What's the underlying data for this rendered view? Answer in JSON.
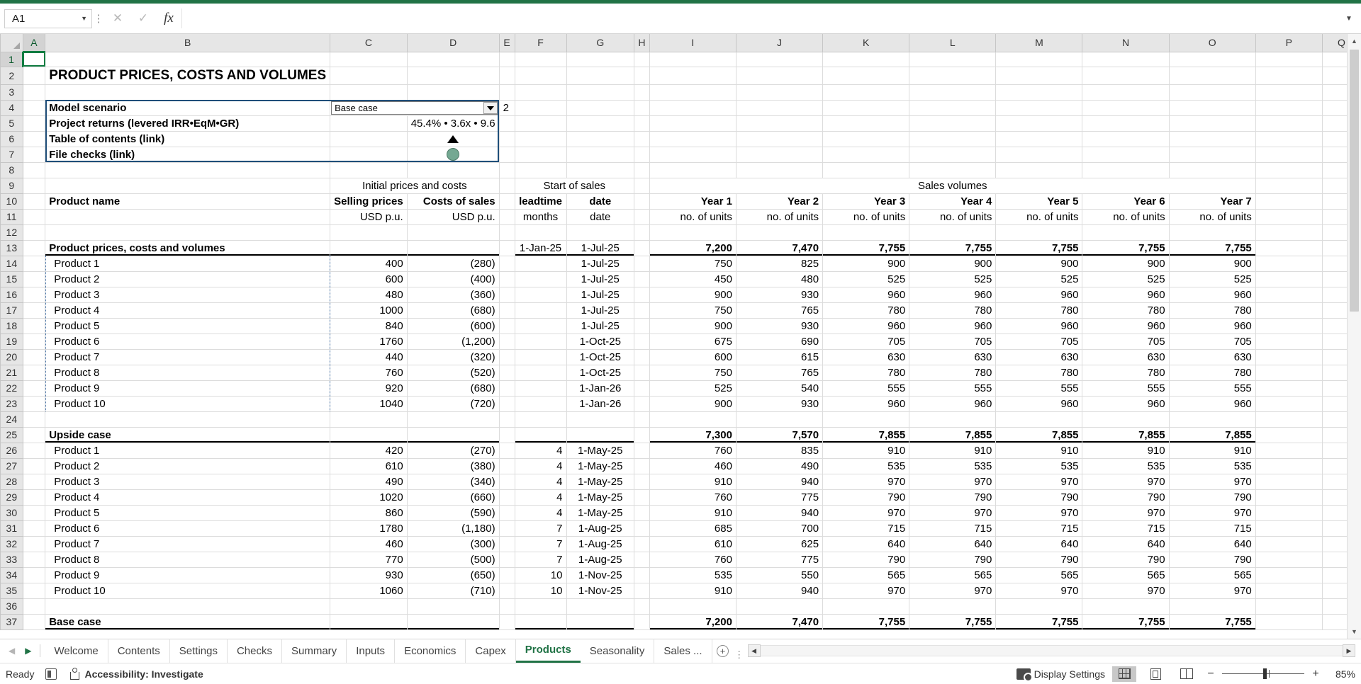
{
  "namebox": {
    "value": "A1"
  },
  "formula_bar": {
    "value": "",
    "cancel_icon": "cancel-icon",
    "confirm_icon": "confirm-icon",
    "fx_icon": "function-icon"
  },
  "columns": [
    "A",
    "B",
    "C",
    "D",
    "E",
    "F",
    "G",
    "H",
    "I",
    "J",
    "K",
    "L",
    "M",
    "N",
    "O",
    "P",
    "Q"
  ],
  "rows": [
    1,
    2,
    3,
    4,
    5,
    6,
    7,
    8,
    9,
    10,
    11,
    12,
    13,
    14,
    15,
    16,
    17,
    18,
    19,
    20,
    21,
    22,
    23,
    24,
    25,
    26,
    27,
    28,
    29,
    30,
    31,
    32,
    33,
    34,
    35,
    36,
    37
  ],
  "sheet": {
    "title": "PRODUCT PRICES, COSTS AND VOLUMES",
    "control_panel": {
      "labels": [
        "Model scenario",
        "Project returns (levered IRR•EqM•GR)",
        "Table of contents (link)",
        "File checks (link)"
      ],
      "scenario_value": "Base case",
      "scenario_index": "2",
      "returns_value": "45.4% • 3.6x • 9.6",
      "toc_icon": "triangle-up-icon",
      "checks_icon": "green-status-dot-icon"
    },
    "group_headers": {
      "initial": "Initial prices and costs",
      "start": "Start of sales",
      "volumes": "Sales volumes"
    },
    "col_headers": {
      "product_name": "Product name",
      "selling_prices": "Selling prices",
      "costs_of_sales": "Costs of sales",
      "leadtime": "leadtime",
      "date": "date",
      "years": [
        "Year 1",
        "Year 2",
        "Year 3",
        "Year 4",
        "Year 5",
        "Year 6",
        "Year 7"
      ]
    },
    "units": {
      "selling_prices": "USD p.u.",
      "costs_of_sales": "USD p.u.",
      "leadtime": "months",
      "date": "date",
      "years": [
        "no. of units",
        "no. of units",
        "no. of units",
        "no. of units",
        "no. of units",
        "no. of units",
        "no. of units"
      ]
    },
    "sections": [
      {
        "name": "Product prices, costs and volumes",
        "row": 13,
        "leadtime_total": "1-Jan-25",
        "date_total": "1-Jul-25",
        "totals": [
          "7,200",
          "7,470",
          "7,755",
          "7,755",
          "7,755",
          "7,755",
          "7,755"
        ],
        "rows": [
          {
            "row": 14,
            "name": "Product 1",
            "price": "400",
            "cost": "(280)",
            "leadtime": "",
            "date": "1-Jul-25",
            "volumes": [
              "750",
              "825",
              "900",
              "900",
              "900",
              "900",
              "900"
            ]
          },
          {
            "row": 15,
            "name": "Product 2",
            "price": "600",
            "cost": "(400)",
            "leadtime": "",
            "date": "1-Jul-25",
            "volumes": [
              "450",
              "480",
              "525",
              "525",
              "525",
              "525",
              "525"
            ]
          },
          {
            "row": 16,
            "name": "Product 3",
            "price": "480",
            "cost": "(360)",
            "leadtime": "",
            "date": "1-Jul-25",
            "volumes": [
              "900",
              "930",
              "960",
              "960",
              "960",
              "960",
              "960"
            ]
          },
          {
            "row": 17,
            "name": "Product 4",
            "price": "1000",
            "cost": "(680)",
            "leadtime": "",
            "date": "1-Jul-25",
            "volumes": [
              "750",
              "765",
              "780",
              "780",
              "780",
              "780",
              "780"
            ]
          },
          {
            "row": 18,
            "name": "Product 5",
            "price": "840",
            "cost": "(600)",
            "leadtime": "",
            "date": "1-Jul-25",
            "volumes": [
              "900",
              "930",
              "960",
              "960",
              "960",
              "960",
              "960"
            ]
          },
          {
            "row": 19,
            "name": "Product 6",
            "price": "1760",
            "cost": "(1,200)",
            "leadtime": "",
            "date": "1-Oct-25",
            "volumes": [
              "675",
              "690",
              "705",
              "705",
              "705",
              "705",
              "705"
            ]
          },
          {
            "row": 20,
            "name": "Product 7",
            "price": "440",
            "cost": "(320)",
            "leadtime": "",
            "date": "1-Oct-25",
            "volumes": [
              "600",
              "615",
              "630",
              "630",
              "630",
              "630",
              "630"
            ]
          },
          {
            "row": 21,
            "name": "Product 8",
            "price": "760",
            "cost": "(520)",
            "leadtime": "",
            "date": "1-Oct-25",
            "volumes": [
              "750",
              "765",
              "780",
              "780",
              "780",
              "780",
              "780"
            ]
          },
          {
            "row": 22,
            "name": "Product 9",
            "price": "920",
            "cost": "(680)",
            "leadtime": "",
            "date": "1-Jan-26",
            "volumes": [
              "525",
              "540",
              "555",
              "555",
              "555",
              "555",
              "555"
            ]
          },
          {
            "row": 23,
            "name": "Product 10",
            "price": "1040",
            "cost": "(720)",
            "leadtime": "",
            "date": "1-Jan-26",
            "volumes": [
              "900",
              "930",
              "960",
              "960",
              "960",
              "960",
              "960"
            ]
          }
        ]
      },
      {
        "name": "Upside case",
        "row": 25,
        "leadtime_total": "",
        "date_total": "",
        "totals": [
          "7,300",
          "7,570",
          "7,855",
          "7,855",
          "7,855",
          "7,855",
          "7,855"
        ],
        "rows": [
          {
            "row": 26,
            "name": "Product 1",
            "price": "420",
            "cost": "(270)",
            "leadtime": "4",
            "date": "1-May-25",
            "volumes": [
              "760",
              "835",
              "910",
              "910",
              "910",
              "910",
              "910"
            ]
          },
          {
            "row": 27,
            "name": "Product 2",
            "price": "610",
            "cost": "(380)",
            "leadtime": "4",
            "date": "1-May-25",
            "volumes": [
              "460",
              "490",
              "535",
              "535",
              "535",
              "535",
              "535"
            ]
          },
          {
            "row": 28,
            "name": "Product 3",
            "price": "490",
            "cost": "(340)",
            "leadtime": "4",
            "date": "1-May-25",
            "volumes": [
              "910",
              "940",
              "970",
              "970",
              "970",
              "970",
              "970"
            ]
          },
          {
            "row": 29,
            "name": "Product 4",
            "price": "1020",
            "cost": "(660)",
            "leadtime": "4",
            "date": "1-May-25",
            "volumes": [
              "760",
              "775",
              "790",
              "790",
              "790",
              "790",
              "790"
            ]
          },
          {
            "row": 30,
            "name": "Product 5",
            "price": "860",
            "cost": "(590)",
            "leadtime": "4",
            "date": "1-May-25",
            "volumes": [
              "910",
              "940",
              "970",
              "970",
              "970",
              "970",
              "970"
            ]
          },
          {
            "row": 31,
            "name": "Product 6",
            "price": "1780",
            "cost": "(1,180)",
            "leadtime": "7",
            "date": "1-Aug-25",
            "volumes": [
              "685",
              "700",
              "715",
              "715",
              "715",
              "715",
              "715"
            ]
          },
          {
            "row": 32,
            "name": "Product 7",
            "price": "460",
            "cost": "(300)",
            "leadtime": "7",
            "date": "1-Aug-25",
            "volumes": [
              "610",
              "625",
              "640",
              "640",
              "640",
              "640",
              "640"
            ]
          },
          {
            "row": 33,
            "name": "Product 8",
            "price": "770",
            "cost": "(500)",
            "leadtime": "7",
            "date": "1-Aug-25",
            "volumes": [
              "760",
              "775",
              "790",
              "790",
              "790",
              "790",
              "790"
            ]
          },
          {
            "row": 34,
            "name": "Product 9",
            "price": "930",
            "cost": "(650)",
            "leadtime": "10",
            "date": "1-Nov-25",
            "volumes": [
              "535",
              "550",
              "565",
              "565",
              "565",
              "565",
              "565"
            ]
          },
          {
            "row": 35,
            "name": "Product 10",
            "price": "1060",
            "cost": "(710)",
            "leadtime": "10",
            "date": "1-Nov-25",
            "volumes": [
              "910",
              "940",
              "970",
              "970",
              "970",
              "970",
              "970"
            ]
          }
        ]
      },
      {
        "name": "Base case",
        "row": 37,
        "leadtime_total": "",
        "date_total": "",
        "totals": [
          "7,200",
          "7,470",
          "7,755",
          "7,755",
          "7,755",
          "7,755",
          "7,755"
        ],
        "rows": []
      }
    ]
  },
  "tabbar": {
    "prev_icon": "nav-prev-icon",
    "next_icon": "nav-next-icon",
    "tabs": [
      "Welcome",
      "Contents",
      "Settings",
      "Checks",
      "Summary",
      "Inputs",
      "Economics",
      "Capex",
      "Products",
      "Seasonality",
      "Sales ..."
    ],
    "active_tab": "Products",
    "add_label": "+"
  },
  "statusbar": {
    "mode": "Ready",
    "macro_icon": "record-macro-icon",
    "accessibility": "Accessibility: Investigate",
    "display_settings": "Display Settings",
    "views": [
      "normal-view-icon",
      "page-layout-icon",
      "page-break-icon"
    ],
    "active_view": "normal-view-icon",
    "zoom_minus": "−",
    "zoom_plus": "+",
    "zoom_level": "85%"
  },
  "colors": {
    "accent_green": "#217346",
    "header_navy": "#1f4e79",
    "input_blue": "#1f4e79",
    "input_fill": "#dce6f1",
    "units_gray": "#d9d9d9",
    "check_green": "#74a892"
  }
}
